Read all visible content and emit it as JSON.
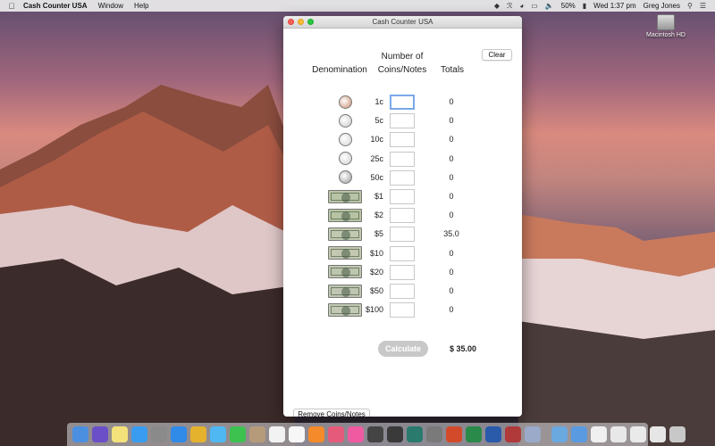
{
  "menubar": {
    "app_name": "Cash Counter USA",
    "menus": [
      "Window",
      "Help"
    ],
    "battery": "50%",
    "clock": "Wed 1:37 pm",
    "user": "Greg Jones"
  },
  "desktop": {
    "drive_label": "Macintosh HD"
  },
  "window": {
    "title": "Cash Counter USA",
    "headers": {
      "denomination": "Denomination",
      "number_line1": "Number of",
      "number_line2": "Coins/Notes",
      "totals": "Totals"
    },
    "clear_label": "Clear",
    "calculate_label": "Calculate",
    "grand_total": "$ 35.00",
    "remove_label": "Remove Coins/Notes",
    "rows": [
      {
        "denom": "1c",
        "qty": "",
        "total": "0",
        "kind": "coin",
        "color": "#c98a6b"
      },
      {
        "denom": "5c",
        "qty": "",
        "total": "0",
        "kind": "coin",
        "color": "#c9c9c9"
      },
      {
        "denom": "10c",
        "qty": "",
        "total": "0",
        "kind": "coin",
        "color": "#d3d3d3"
      },
      {
        "denom": "25c",
        "qty": "",
        "total": "0",
        "kind": "coin",
        "color": "#cfcfcf"
      },
      {
        "denom": "50c",
        "qty": "",
        "total": "0",
        "kind": "coin",
        "color": "#9a9a9a"
      },
      {
        "denom": "$1",
        "qty": "",
        "total": "0",
        "kind": "note",
        "color": "#b9c4a6"
      },
      {
        "denom": "$2",
        "qty": "",
        "total": "0",
        "kind": "note",
        "color": "#b7c3a3"
      },
      {
        "denom": "$5",
        "qty": "",
        "total": "35.0",
        "kind": "note",
        "color": "#c2c9b0"
      },
      {
        "denom": "$10",
        "qty": "",
        "total": "0",
        "kind": "note",
        "color": "#c4c8b0"
      },
      {
        "denom": "$20",
        "qty": "",
        "total": "0",
        "kind": "note",
        "color": "#bfc6ae"
      },
      {
        "denom": "$50",
        "qty": "",
        "total": "0",
        "kind": "note",
        "color": "#c0c5b2"
      },
      {
        "denom": "$100",
        "qty": "",
        "total": "0",
        "kind": "note",
        "color": "#c3c9b5"
      }
    ]
  },
  "dock": {
    "icons": [
      {
        "name": "finder-icon",
        "color": "#4a8fe0"
      },
      {
        "name": "siri-icon",
        "color": "#6a4fc9"
      },
      {
        "name": "notes-icon",
        "color": "#f3e27a"
      },
      {
        "name": "app-store-icon",
        "color": "#3a9cf0"
      },
      {
        "name": "launchpad-icon",
        "color": "#8a8a8a"
      },
      {
        "name": "safari-icon",
        "color": "#2f8ae8"
      },
      {
        "name": "chrome-icon",
        "color": "#e4b22d"
      },
      {
        "name": "messages-icon",
        "color": "#4fb8f2"
      },
      {
        "name": "facetime-icon",
        "color": "#3dc14f"
      },
      {
        "name": "contacts-icon",
        "color": "#b59b7a"
      },
      {
        "name": "calendar-icon",
        "color": "#f2f2f2"
      },
      {
        "name": "reminders-icon",
        "color": "#f7f7f7"
      },
      {
        "name": "ibooks-icon",
        "color": "#f58a2a"
      },
      {
        "name": "photos-icon",
        "color": "#e55a7a"
      },
      {
        "name": "itunes-icon",
        "color": "#ef5aa0"
      },
      {
        "name": "movie-icon",
        "color": "#444444"
      },
      {
        "name": "calculator-icon",
        "color": "#3a3a3a"
      },
      {
        "name": "time-machine-icon",
        "color": "#2a7a6e"
      },
      {
        "name": "system-prefs-icon",
        "color": "#7a7a7a"
      },
      {
        "name": "powerpoint-icon",
        "color": "#d34a2a"
      },
      {
        "name": "excel-icon",
        "color": "#2a8a4a"
      },
      {
        "name": "word-icon",
        "color": "#2a5aaa"
      },
      {
        "name": "flag-app-icon",
        "color": "#b03a3a"
      },
      {
        "name": "preview-icon",
        "color": "#9aaac8"
      },
      {
        "name": "folder-icon",
        "color": "#6aa8e0"
      },
      {
        "name": "downloads-icon",
        "color": "#5a9ae0"
      },
      {
        "name": "document-icon",
        "color": "#f0f0f0"
      },
      {
        "name": "document-2-icon",
        "color": "#e8e8e8"
      },
      {
        "name": "document-3-icon",
        "color": "#eaeaea"
      },
      {
        "name": "document-4-icon",
        "color": "#e6e6e6"
      },
      {
        "name": "trash-icon",
        "color": "#c8c8c8"
      }
    ]
  }
}
